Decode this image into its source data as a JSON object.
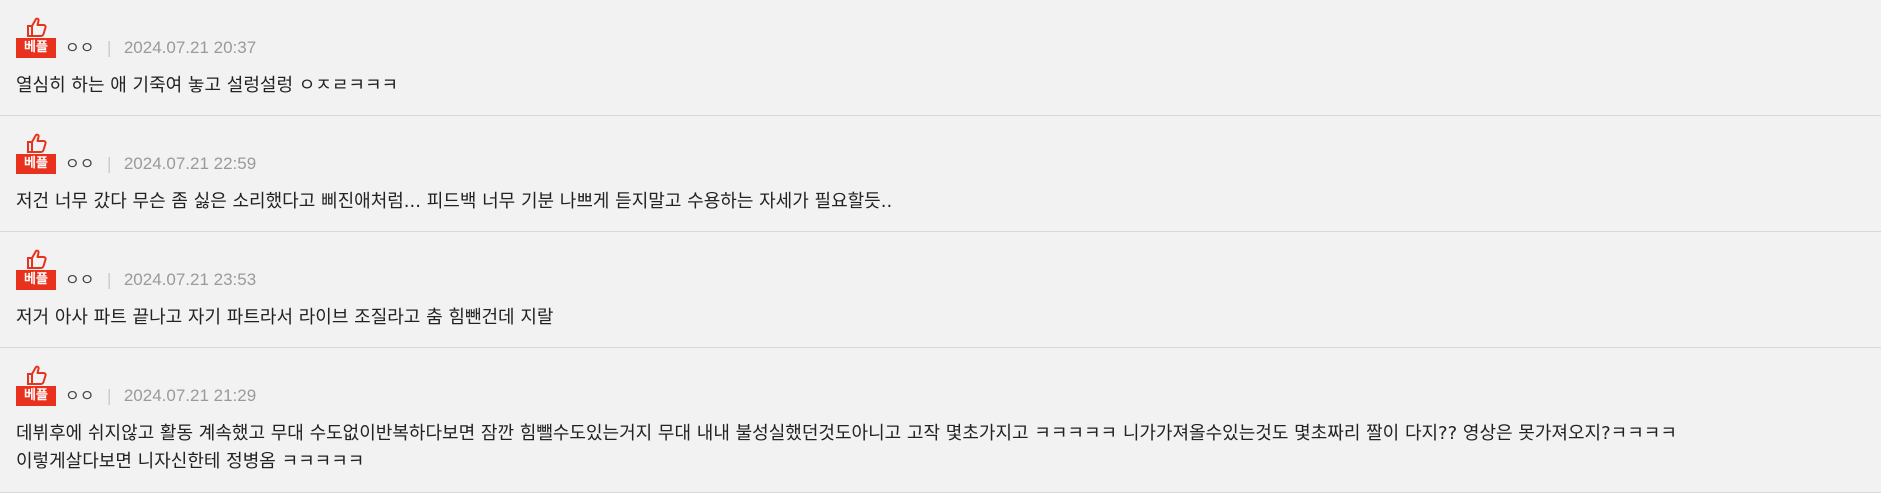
{
  "comments": [
    {
      "badge": "베플",
      "nickname": "ㅇㅇ",
      "separator": "|",
      "date": "2024.07.21 20:37",
      "text": "열심히 하는 애 기죽여 놓고 설렁설렁 ㅇㅈㄹㅋㅋㅋ"
    },
    {
      "badge": "베플",
      "nickname": "ㅇㅇ",
      "separator": "|",
      "date": "2024.07.21 22:59",
      "text": "저건 너무 갔다 무슨 좀 싫은 소리했다고 삐진애처럼... 피드백 너무 기분 나쁘게 듣지말고 수용하는 자세가 필요할듯.."
    },
    {
      "badge": "베플",
      "nickname": "ㅇㅇ",
      "separator": "|",
      "date": "2024.07.21 23:53",
      "text": "저거 아사 파트 끝나고 자기 파트라서 라이브 조질라고 춤 힘뺀건데 지랄"
    },
    {
      "badge": "베플",
      "nickname": "ㅇㅇ",
      "separator": "|",
      "date": "2024.07.21 21:29",
      "text": "데뷔후에 쉬지않고 활동 계속했고 무대 수도없이반복하다보면 잠깐 힘뺄수도있는거지 무대 내내 불성실했던것도아니고 고작 몇초가지고 ㅋㅋㅋㅋㅋ 니가가져올수있는것도 몇초짜리 짤이 다지?? 영상은 못가져오지?ㅋㅋㅋㅋ\n이렇게살다보면 니자신한테 정병옴 ㅋㅋㅋㅋㅋ"
    }
  ],
  "icons": {
    "thumb": "thumbs-up-icon"
  },
  "colors": {
    "badge_bg": "#e8321e",
    "background": "#f2f2f2",
    "date": "#9a9a9a",
    "divider": "#d8d8d8"
  }
}
